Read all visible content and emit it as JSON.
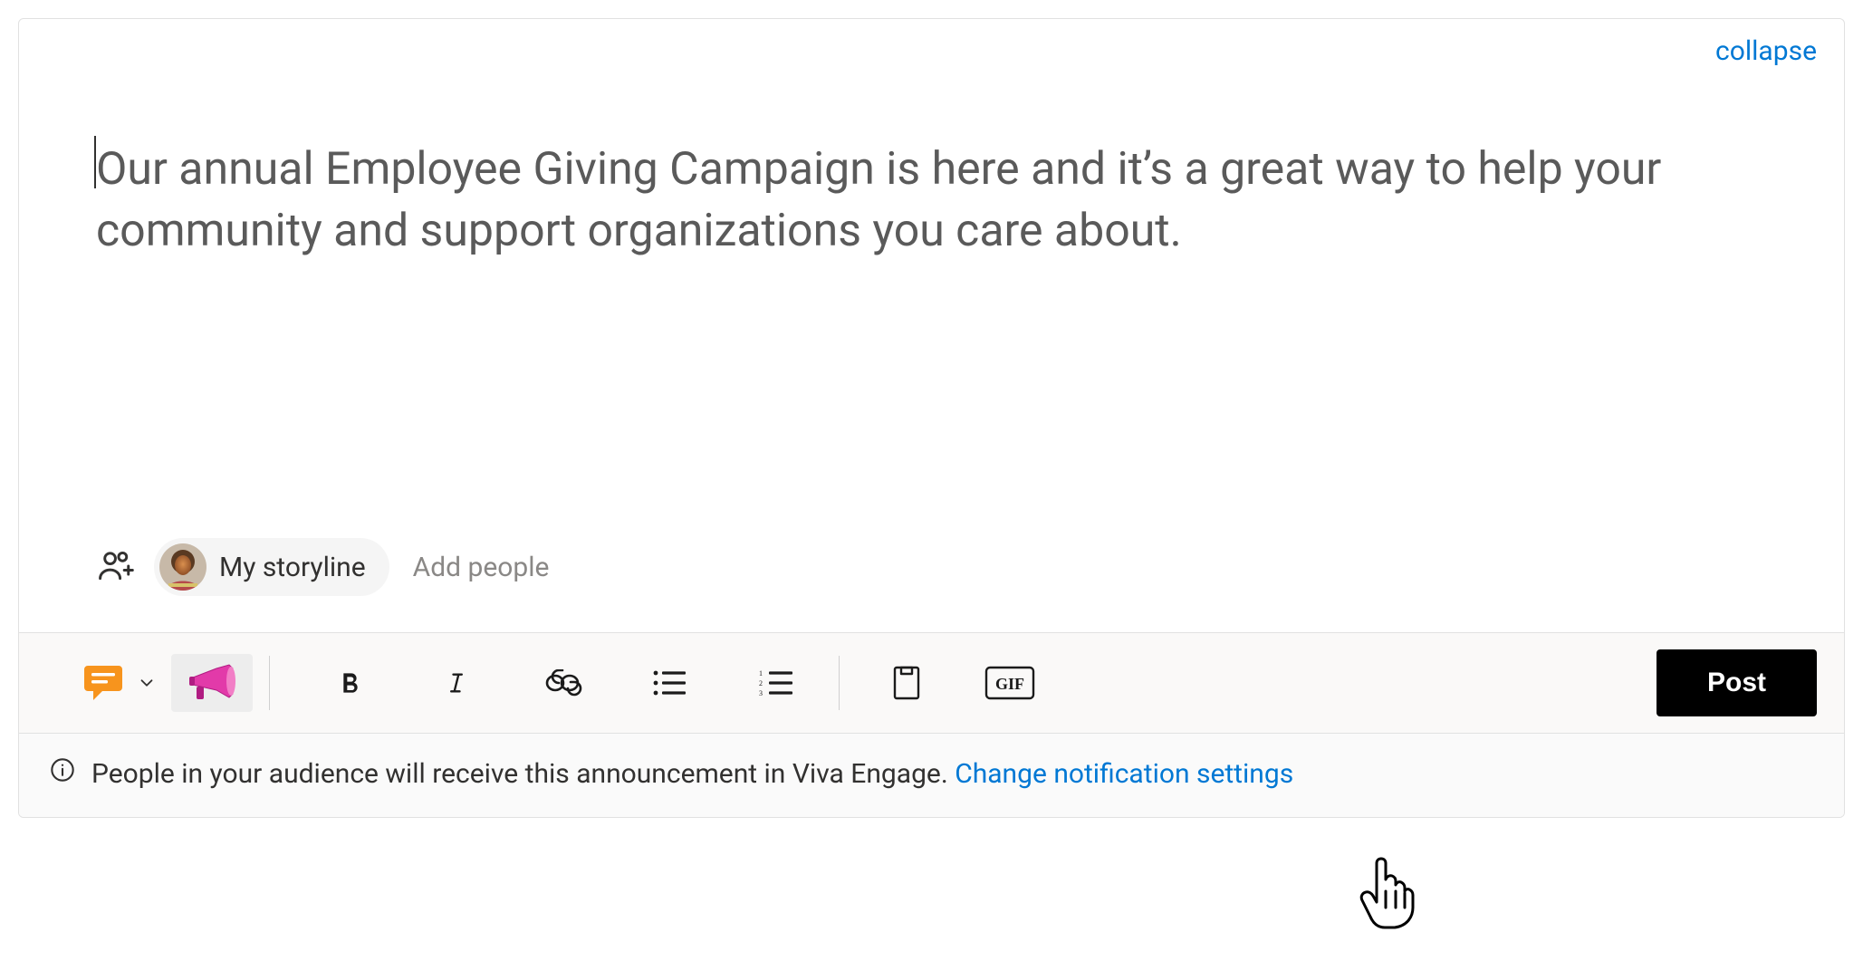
{
  "header": {
    "collapse_label": "collapse"
  },
  "composer": {
    "body_text": "Our annual Employee Giving Campaign is here and it’s a great way to help your community and support organizations you care about."
  },
  "recipients": {
    "my_storyline_label": "My storyline",
    "add_people_placeholder": "Add people"
  },
  "toolbar": {
    "post_label": "Post",
    "gif_label": "GIF"
  },
  "info": {
    "message": "People in your audience will receive this announcement in Viva Engage. ",
    "link_label": "Change notification settings"
  }
}
